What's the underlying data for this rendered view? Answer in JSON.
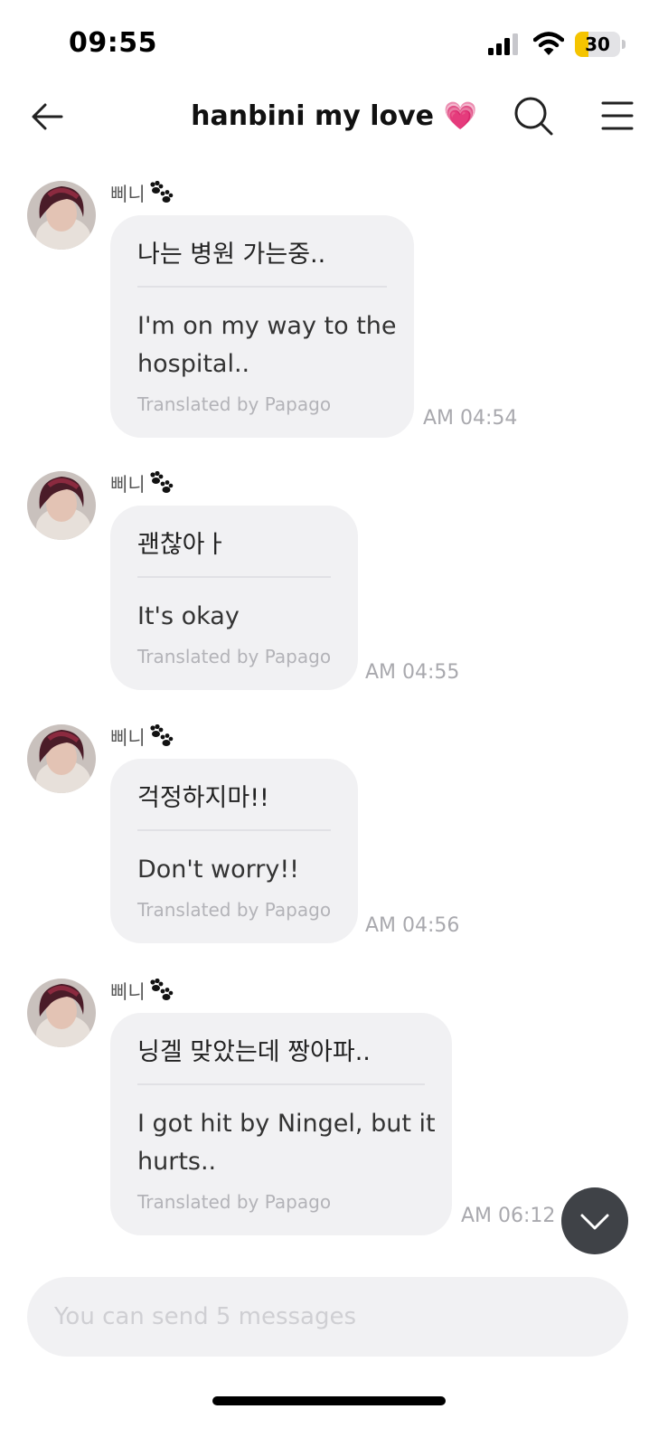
{
  "status_bar": {
    "time": "09:55",
    "battery_level": "30",
    "battery_color": "#f5c400"
  },
  "header": {
    "title": "hanbini my love 💗",
    "back_icon": "arrow-left-icon",
    "search_icon": "search-icon",
    "menu_icon": "hamburger-menu-icon"
  },
  "messages": [
    {
      "sender": "삐니",
      "original": "나는 병원 가는중..",
      "translation_lines": [
        "I'm on my way to the",
        "hospital.."
      ],
      "translated_by": "Translated by Papago",
      "time": "AM 04:54"
    },
    {
      "sender": "삐니",
      "original": "괜찮아ㅏ",
      "translation_lines": [
        "It's okay"
      ],
      "translated_by": "Translated by Papago",
      "time": "AM 04:55"
    },
    {
      "sender": "삐니",
      "original": "걱정하지마!!",
      "translation_lines": [
        "Don't worry!!"
      ],
      "translated_by": "Translated by Papago",
      "time": "AM 04:56"
    },
    {
      "sender": "삐니",
      "original": "닝겔 맞았는데 짱아파..",
      "translation_lines": [
        "I got hit by Ningel, but it",
        "hurts.."
      ],
      "translated_by": "Translated by Papago",
      "time": "AM 06:12"
    }
  ],
  "scroll_button_icon": "chevron-down-icon",
  "input": {
    "placeholder": "You can send 5 messages",
    "value": ""
  }
}
